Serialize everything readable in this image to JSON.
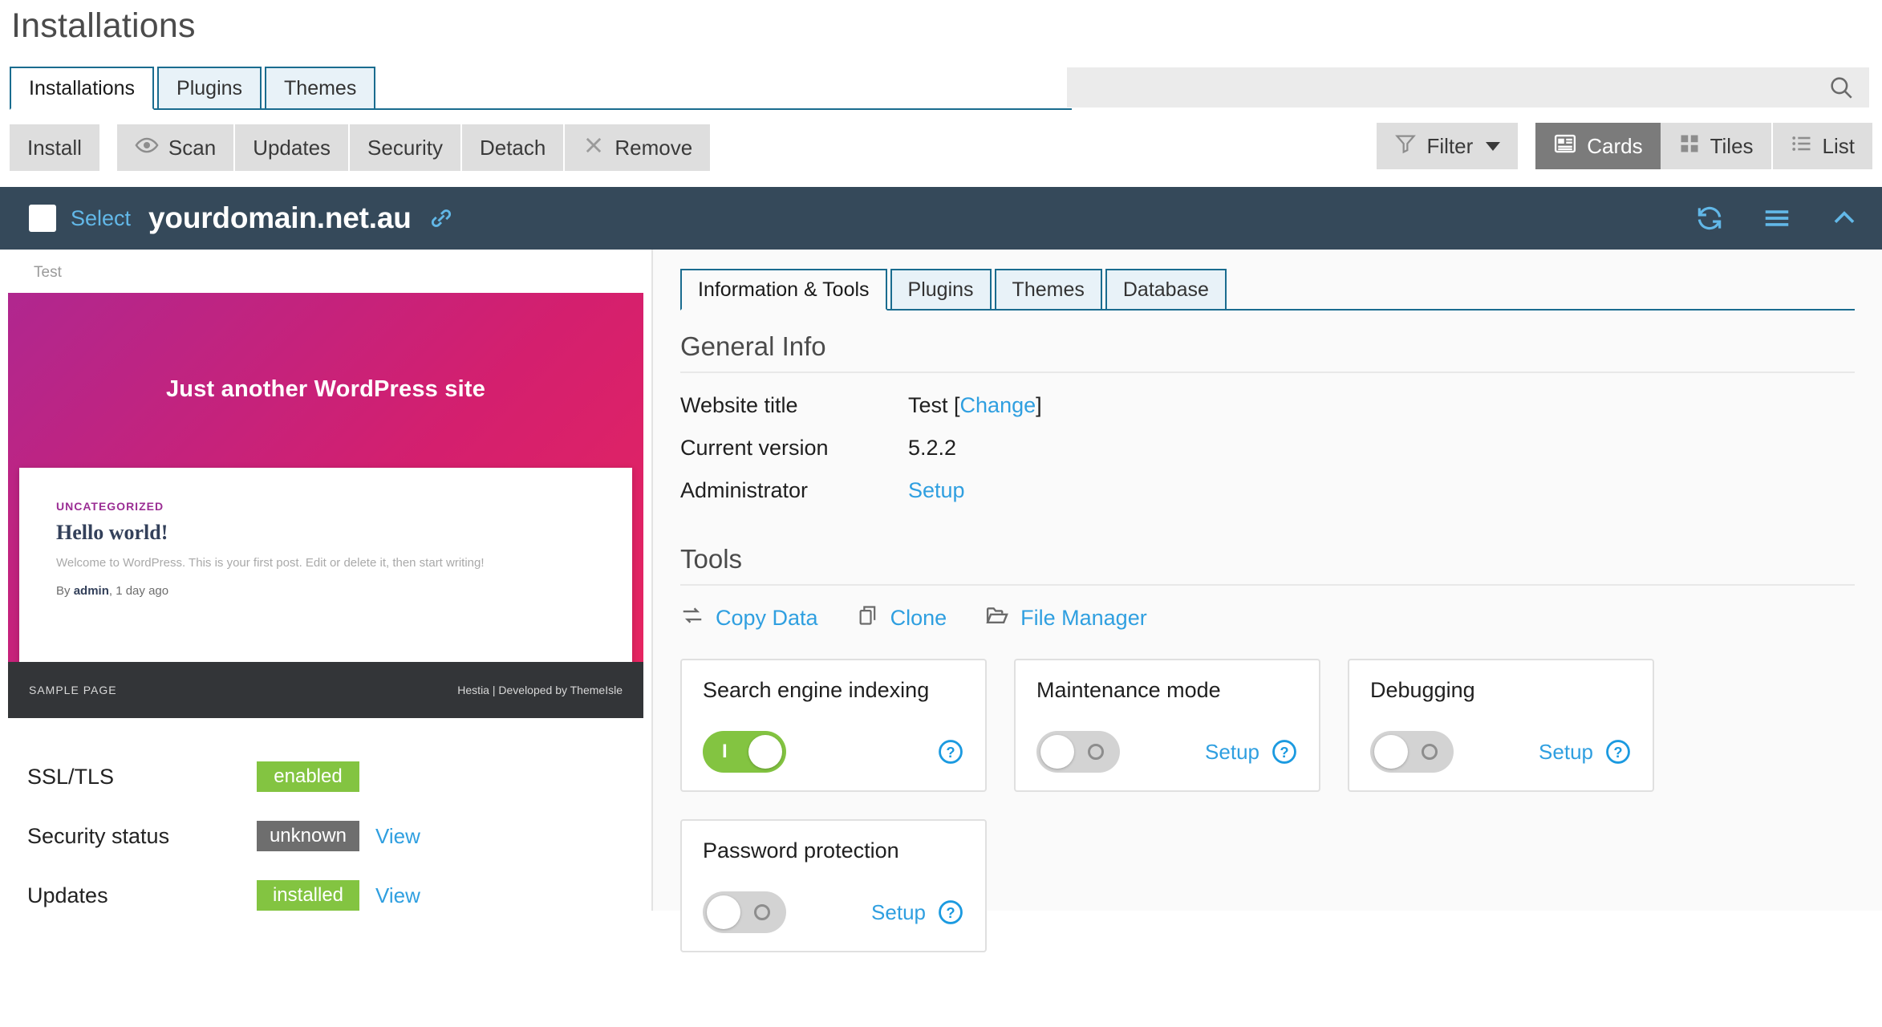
{
  "page": {
    "title": "Installations"
  },
  "outer_tabs": [
    {
      "label": "Installations",
      "active": true
    },
    {
      "label": "Plugins",
      "active": false
    },
    {
      "label": "Themes",
      "active": false
    }
  ],
  "search": {
    "value": "",
    "placeholder": "",
    "icon": "search-icon"
  },
  "toolbar": {
    "install_label": "Install",
    "scan_label": "Scan",
    "updates_label": "Updates",
    "security_label": "Security",
    "detach_label": "Detach",
    "remove_label": "Remove",
    "filter_label": "Filter",
    "cards_label": "Cards",
    "tiles_label": "Tiles",
    "list_label": "List",
    "active_view": "Cards",
    "icons": {
      "scan": "eye-icon",
      "remove": "close-icon",
      "filter": "funnel-icon",
      "cards": "card-view-icon",
      "tiles": "grid-view-icon",
      "list": "list-view-icon",
      "filter_caret": "chevron-down-icon"
    }
  },
  "installation": {
    "select_label": "Select",
    "domain": "yourdomain.net.au",
    "link_icon": "chain-link-icon",
    "header_icons": {
      "refresh": "refresh-icon",
      "menu": "hamburger-menu-icon",
      "collapse": "chevron-up-icon"
    },
    "accent_dark": "#35495a",
    "accent_blue": "#62b8e8"
  },
  "preview": {
    "label": "Test",
    "hero_text": "Just another WordPress site",
    "post": {
      "category": "UNCATEGORIZED",
      "title": "Hello world!",
      "excerpt": "Welcome to WordPress. This is your first post. Edit or delete it, then start writing!",
      "byline_prefix": "By",
      "author": "admin",
      "byline_suffix": ", 1 day ago"
    },
    "footer_left": "SAMPLE PAGE",
    "footer_right": "Hestia | Developed by ThemeIsle",
    "gradient_from": "#b0278f",
    "gradient_to": "#e8265f"
  },
  "status": [
    {
      "key": "SSL/TLS",
      "badge": "enabled",
      "badge_color": "green",
      "link": ""
    },
    {
      "key": "Security status",
      "badge": "unknown",
      "badge_color": "gray",
      "link": "View"
    },
    {
      "key": "Updates",
      "badge": "installed",
      "badge_color": "green",
      "link": "View"
    }
  ],
  "inner_tabs": [
    {
      "label": "Information & Tools",
      "active": true
    },
    {
      "label": "Plugins",
      "active": false
    },
    {
      "label": "Themes",
      "active": false
    },
    {
      "label": "Database",
      "active": false
    }
  ],
  "general_info": {
    "heading": "General Info",
    "rows": [
      {
        "key": "Website title",
        "value": "Test",
        "open_bracket": " [",
        "link": "Change",
        "close_bracket": "]"
      },
      {
        "key": "Current version",
        "value": "5.2.2",
        "open_bracket": "",
        "link": "",
        "close_bracket": ""
      },
      {
        "key": "Administrator",
        "value": "",
        "open_bracket": "",
        "link": "Setup",
        "close_bracket": ""
      }
    ]
  },
  "tools": {
    "heading": "Tools",
    "links": [
      {
        "label": "Copy Data",
        "icon": "exchange-icon"
      },
      {
        "label": "Clone",
        "icon": "copy-icon"
      },
      {
        "label": "File Manager",
        "icon": "folder-open-icon"
      }
    ]
  },
  "feature_cards": [
    {
      "title": "Search engine indexing",
      "state": "on",
      "setup_label": "",
      "help_icon": "help-circle-icon"
    },
    {
      "title": "Maintenance mode",
      "state": "off",
      "setup_label": "Setup",
      "help_icon": "help-circle-icon"
    },
    {
      "title": "Debugging",
      "state": "off",
      "setup_label": "Setup",
      "help_icon": "help-circle-icon"
    },
    {
      "title": "Password protection",
      "state": "off",
      "setup_label": "Setup",
      "help_icon": "help-circle-icon"
    }
  ],
  "colors": {
    "link_blue": "#2f9fe0",
    "tab_border": "#1a6c8f",
    "badge_green": "#83c441",
    "badge_gray": "#6e6e6e"
  }
}
